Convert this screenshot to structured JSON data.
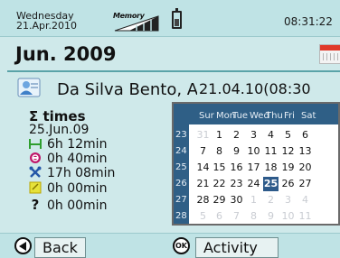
{
  "status": {
    "day": "Wednesday",
    "date": "21.Apr.2010",
    "memory_label": "Memory",
    "time": "08:31:22"
  },
  "title": "Jun. 2009",
  "patient": {
    "name": "Da Silva Bento, An",
    "timestamp": "21.04.10(08:30"
  },
  "times": {
    "header": "Σ times",
    "date": "25.Jun.09",
    "rows": [
      {
        "icon": "work-bracket-icon",
        "value": "6h 12min"
      },
      {
        "icon": "break-circle-icon",
        "value": "0h 40min"
      },
      {
        "icon": "tools-icon",
        "value": "17h 08min"
      },
      {
        "icon": "note-icon",
        "value": "0h 00min"
      },
      {
        "icon": "question-icon",
        "value": "0h 00min"
      }
    ]
  },
  "calendar": {
    "dow": [
      "Sur",
      "Mon",
      "Tue",
      "Wed",
      "Thu",
      "Fri",
      "Sat"
    ],
    "weeks": [
      {
        "wk": "23",
        "days": [
          "31",
          "1",
          "2",
          "3",
          "4",
          "5",
          "6"
        ],
        "other": [
          true,
          false,
          false,
          false,
          false,
          false,
          false
        ]
      },
      {
        "wk": "24",
        "days": [
          "7",
          "8",
          "9",
          "10",
          "11",
          "12",
          "13"
        ],
        "other": [
          false,
          false,
          false,
          false,
          false,
          false,
          false
        ]
      },
      {
        "wk": "25",
        "days": [
          "14",
          "15",
          "16",
          "17",
          "18",
          "19",
          "20"
        ],
        "other": [
          false,
          false,
          false,
          false,
          false,
          false,
          false
        ]
      },
      {
        "wk": "26",
        "days": [
          "21",
          "22",
          "23",
          "24",
          "25",
          "26",
          "27"
        ],
        "other": [
          false,
          false,
          false,
          false,
          false,
          false,
          false
        ]
      },
      {
        "wk": "27",
        "days": [
          "28",
          "29",
          "30",
          "1",
          "2",
          "3",
          "4"
        ],
        "other": [
          false,
          false,
          false,
          true,
          true,
          true,
          true
        ]
      },
      {
        "wk": "28",
        "days": [
          "5",
          "6",
          "7",
          "8",
          "9",
          "10",
          "11"
        ],
        "other": [
          true,
          true,
          true,
          true,
          true,
          true,
          true
        ]
      }
    ],
    "selected": "25"
  },
  "softkeys": {
    "back_label": "Back",
    "ok_symbol": "OK",
    "activity_label": "Activity"
  },
  "colors": {
    "background": "#cfe9ea",
    "calendar_header": "#2f5f86",
    "selected_day": "#2d5a8a",
    "work_icon": "#2e9e2e",
    "break_icon": "#c0186a",
    "tools_icon": "#2457a8",
    "note_icon": "#e6e23a"
  }
}
